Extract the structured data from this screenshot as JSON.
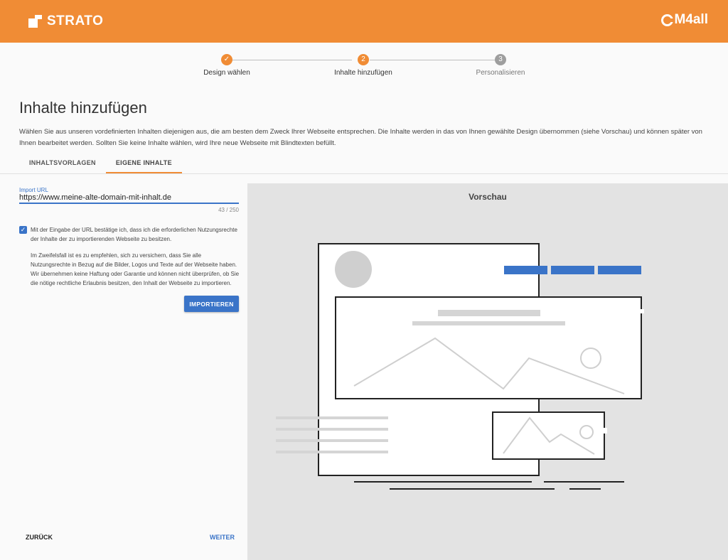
{
  "header": {
    "brand": "STRATO",
    "partner": "M4all"
  },
  "stepper": {
    "steps": [
      {
        "label": "Design wählen",
        "marker": "✓",
        "state": "done"
      },
      {
        "label": "Inhalte hinzufügen",
        "marker": "2",
        "state": "active"
      },
      {
        "label": "Personalisieren",
        "marker": "3",
        "state": "todo"
      }
    ]
  },
  "page": {
    "title": "Inhalte hinzufügen",
    "description": "Wählen Sie aus unseren vordefinierten Inhalten diejenigen aus, die am besten dem Zweck Ihrer Webseite entsprechen. Die Inhalte werden in das von Ihnen gewählte Design übernommen (siehe Vorschau) und können später von Ihnen bearbeitet werden. Sollten Sie keine Inhalte wählen, wird Ihre neue Webseite mit Blindtexten befüllt."
  },
  "tabs": [
    {
      "label": "INHALTSVORLAGEN",
      "active": false
    },
    {
      "label": "EIGENE INHALTE",
      "active": true
    }
  ],
  "import": {
    "label": "Import URL",
    "value": "https://www.meine-alte-domain-mit-inhalt.de",
    "char_count": "43 / 250",
    "checkbox_checked": true,
    "consent_text": "Mit der Eingabe der URL bestätige ich, dass ich die erforderlichen Nutzungsrechte der Inhalte der zu importierenden Webseite zu besitzen.",
    "note_text": "Im Zweifelsfall ist es zu empfehlen, sich zu versichern, dass Sie alle Nutzungsrechte in Bezug auf die Bilder, Logos und Texte auf der Webseite haben. Wir übernehmen keine Haftung oder Garantie und können nicht überprüfen, ob Sie die nötige rechtliche Erlaubnis besitzen, den Inhalt der Webseite zu importieren.",
    "button_label": "IMPORTIEREN"
  },
  "footer": {
    "back_label": "ZURÜCK",
    "next_label": "WEITER"
  },
  "preview": {
    "title": "Vorschau"
  },
  "colors": {
    "brand_orange": "#f08c35",
    "accent_blue": "#3a74c8",
    "step_todo": "#9e9e9e",
    "preview_bg": "#e3e3e3"
  }
}
